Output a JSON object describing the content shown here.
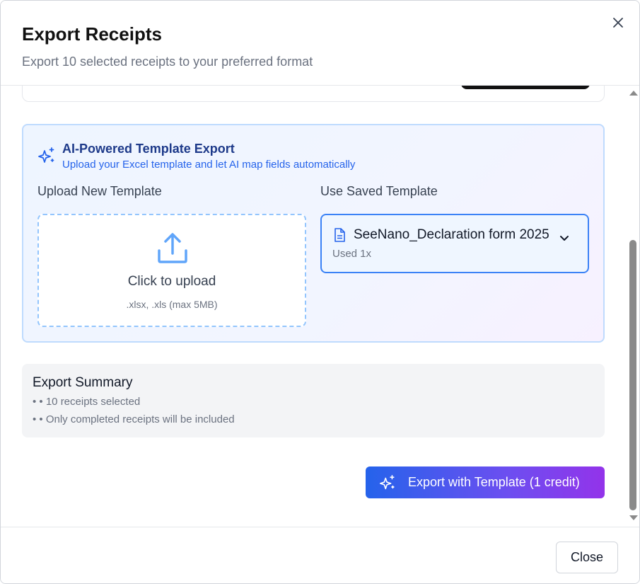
{
  "dialog": {
    "title": "Export Receipts",
    "subtitle": "Export 10 selected receipts to your preferred format",
    "close_icon": "close-icon"
  },
  "ai_template": {
    "icon": "sparkles-icon",
    "title": "AI-Powered Template Export",
    "subtitle": "Upload your Excel template and let AI map fields automatically",
    "upload_column_label": "Upload New Template",
    "saved_column_label": "Use Saved Template",
    "upload": {
      "icon": "upload-icon",
      "label": "Click to upload",
      "hint": ".xlsx, .xls (max 5MB)"
    },
    "saved": {
      "icon": "file-icon",
      "selected_name": "SeeNano_Declaration form 2025",
      "usage": "Used 1x",
      "chevron_icon": "chevron-down-icon"
    }
  },
  "summary": {
    "title": "Export Summary",
    "items": [
      "• • 10 receipts selected",
      "• • Only completed receipts will be included"
    ]
  },
  "export_button": {
    "icon": "sparkles-icon",
    "label": "Export with Template (1 credit)"
  },
  "footer": {
    "close_label": "Close"
  },
  "colors": {
    "accent_blue": "#2563eb",
    "accent_purple": "#9333ea",
    "card_border": "#bfdbfe",
    "title_navy": "#1e3a8a"
  }
}
